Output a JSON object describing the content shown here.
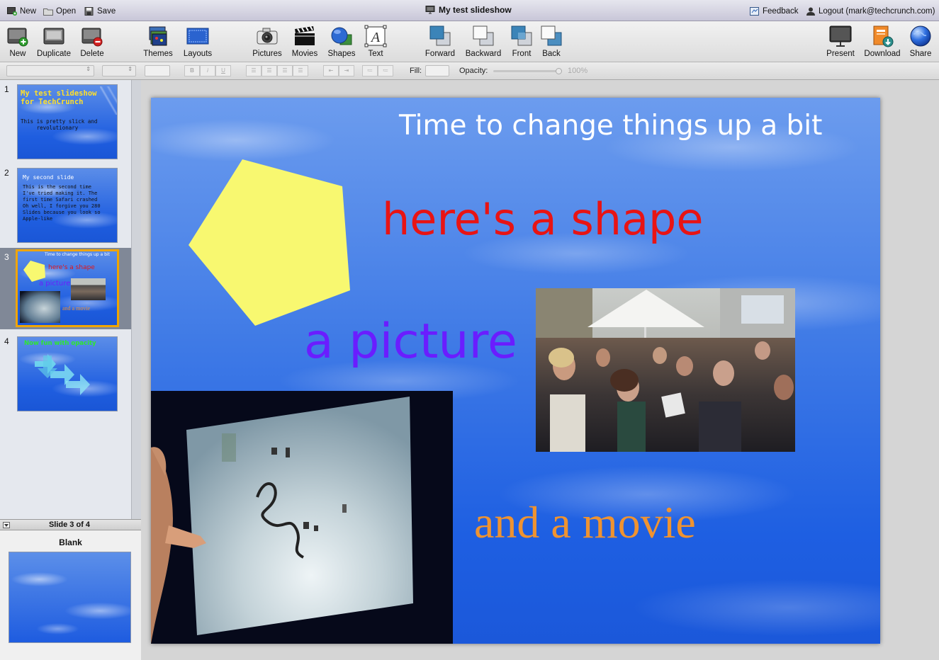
{
  "topbar": {
    "new_label": "New",
    "open_label": "Open",
    "save_label": "Save",
    "document_title": "My test slideshow",
    "feedback_label": "Feedback",
    "logout_label": "Logout (mark@techcrunch.com)"
  },
  "toolbar": {
    "new": "New",
    "duplicate": "Duplicate",
    "delete": "Delete",
    "themes": "Themes",
    "layouts": "Layouts",
    "pictures": "Pictures",
    "movies": "Movies",
    "shapes": "Shapes",
    "text": "Text",
    "forward": "Forward",
    "backward": "Backward",
    "front": "Front",
    "back": "Back",
    "present": "Present",
    "download": "Download",
    "share": "Share"
  },
  "formatbar": {
    "bold": "B",
    "italic": "i",
    "underline": "U",
    "fill_label": "Fill:",
    "opacity_label": "Opacity:",
    "opacity_value": "100%",
    "opacity_fraction": 1.0
  },
  "slides": [
    {
      "number": "1",
      "title": "My test slideshow\nfor TechCrunch",
      "body": "This is pretty slick and\n     revolutionary"
    },
    {
      "number": "2",
      "title": "My second slide",
      "body": "This is the second time\nI've tried making it. The\nfirst time Safari crashed\nOh well, I forgive you 280\nSlides because you look so\nApple-like"
    },
    {
      "number": "3",
      "title": "Time to change things up a bit",
      "shape": "here's a shape",
      "picture": "a picture",
      "movie": "and a movie"
    },
    {
      "number": "4",
      "title": "Now fun with opacity"
    }
  ],
  "selected_slide": 3,
  "slide_info": "Slide 3 of 4",
  "layout_name": "Blank",
  "current_slide": {
    "title": "Time to change things up a bit",
    "shape_text": "here's a shape",
    "picture_text": "a picture",
    "movie_text": "and a movie"
  },
  "colors": {
    "title_text": "#ffffff",
    "shape_text": "#e81414",
    "picture_text": "#6a1dff",
    "movie_text": "#ef9331",
    "pentagon_fill": "#f8f870",
    "selection_border": "#f0a500",
    "slide_background": "#3f7ae6"
  },
  "icons": {
    "new": "new-slide-icon",
    "duplicate": "duplicate-slide-icon",
    "delete": "delete-slide-icon",
    "themes": "themes-icon",
    "layouts": "layouts-icon",
    "pictures": "camera-icon",
    "movies": "clapperboard-icon",
    "shapes": "shapes-icon",
    "text": "text-box-icon",
    "present": "projector-screen-icon",
    "download": "download-icon",
    "share": "globe-icon"
  }
}
